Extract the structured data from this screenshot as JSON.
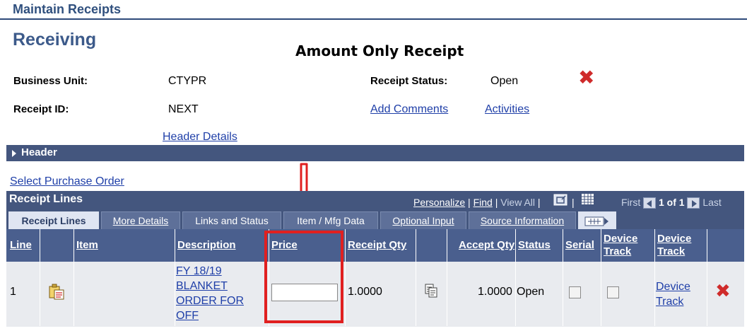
{
  "header": {
    "title": "Maintain Receipts"
  },
  "page": {
    "title": "Receiving",
    "annotation": "Amount Only Receipt"
  },
  "fields": {
    "business_unit_label": "Business Unit:",
    "business_unit_value": "CTYPR",
    "receipt_id_label": "Receipt ID:",
    "receipt_id_value": "NEXT",
    "receipt_status_label": "Receipt Status:",
    "receipt_status_value": "Open"
  },
  "links": {
    "add_comments": "Add Comments",
    "activities": "Activities",
    "header_details": "Header Details",
    "select_purchase_order": "Select Purchase Order"
  },
  "header_section": {
    "label": "Header"
  },
  "grid": {
    "title": "Receipt Lines",
    "personalize": "Personalize",
    "find": "Find",
    "view_all": "View All",
    "first": "First",
    "pager": "1 of 1",
    "last": "Last",
    "tabs": [
      "Receipt Lines",
      "More Details",
      "Links and Status",
      "Item / Mfg Data",
      "Optional Input",
      "Source Information"
    ],
    "columns": {
      "line": "Line",
      "item": "Item",
      "description": "Description",
      "price": "Price",
      "receipt_qty": "Receipt Qty",
      "accept_qty": "Accept Qty",
      "status": "Status",
      "serial": "Serial",
      "device_track_1a": "Device",
      "device_track_1b": "Track",
      "device_track_2a": "Device",
      "device_track_2b": "Track"
    },
    "row": {
      "line": "1",
      "desc_1": "FY 18/19",
      "desc_2": "BLANKET",
      "desc_3": "ORDER FOR",
      "desc_4": "OFF",
      "price": "",
      "receipt_qty": "1.0000",
      "accept_qty": "1.0000",
      "status": "Open",
      "device_track_link_a": "Device",
      "device_track_link_b": "Track"
    }
  },
  "colors": {
    "brand_navy": "#44567e",
    "delete_red": "#cf2b2b",
    "highlight_red": "#e02020",
    "link_blue": "#1f3fa8"
  }
}
